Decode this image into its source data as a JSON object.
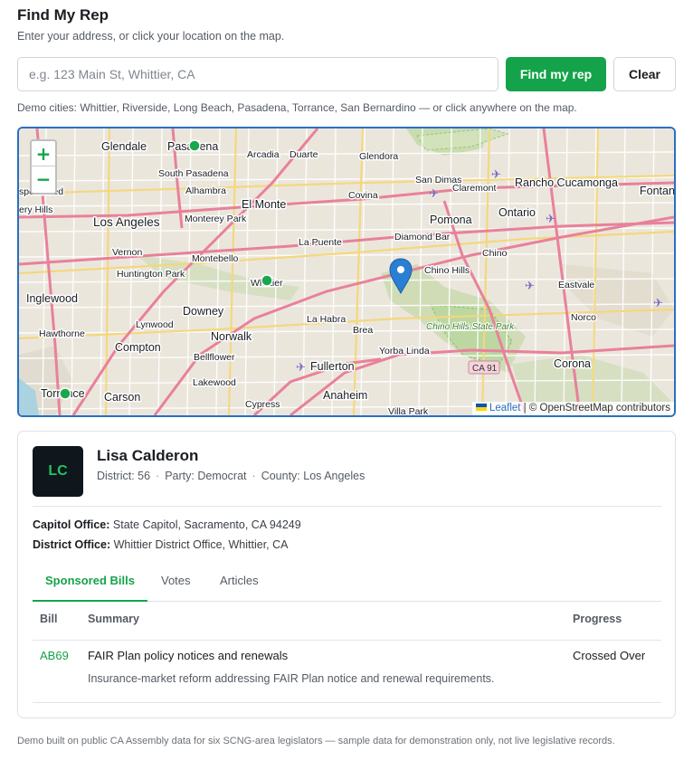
{
  "header": {
    "title": "Find My Rep",
    "subtitle": "Enter your address, or click your location on the map."
  },
  "search": {
    "placeholder": "e.g. 123 Main St, Whittier, CA",
    "value": "",
    "submit_label": "Find my rep",
    "clear_label": "Clear"
  },
  "demo_hint": "Demo cities: Whittier, Riverside, Long Beach, Pasadena, Torrance, San Bernardino — or click anywhere on the map.",
  "map": {
    "zoom_in": "+",
    "zoom_out": "−",
    "attribution_leaflet": "Leaflet",
    "attribution_rest": "| © OpenStreetMap contributors",
    "places": {
      "glendale": "Glendale",
      "pasadena": "Pasadena",
      "arcadia": "Arcadia",
      "duarte": "Duarte",
      "glendora": "Glendora",
      "south_pasadena": "South Pasadena",
      "alhambra": "Alhambra",
      "san_dimas": "San Dimas",
      "claremont": "Claremont",
      "rancho_cucamonga": "Rancho Cucamonga",
      "fontana": "Fontan",
      "covina": "Covina",
      "sponsored": "sponsored",
      "hills": "ery Hills",
      "el_monte": "El Monte",
      "monterey_park": "Monterey Park",
      "los_angeles": "Los Angeles",
      "pomona": "Pomona",
      "ontario": "Ontario",
      "la_puente": "La Puente",
      "diamond_bar": "Diamond Bar",
      "montebello": "Montebello",
      "vernon": "Vernon",
      "huntington_park": "Huntington Park",
      "chino": "Chino",
      "chino_hills": "Chino Hills",
      "whittier": "Whittier",
      "eastvale": "Eastvale",
      "inglewood": "Inglewood",
      "downey": "Downey",
      "la_habra": "La Habra",
      "lynwood": "Lynwood",
      "brea": "Brea",
      "chino_hills_park": "Chino Hills State Park",
      "norco": "Norco",
      "hawthorne": "Hawthorne",
      "norwalk": "Norwalk",
      "compton": "Compton",
      "yorba_linda": "Yorba Linda",
      "bellflower": "Bellflower",
      "fullerton": "Fullerton",
      "ca91": "CA 91",
      "corona": "Corona",
      "lakewood": "Lakewood",
      "torrance": "Torrance",
      "carson": "Carson",
      "anaheim": "Anaheim",
      "cypress": "Cypress",
      "villa_park": "Villa Park"
    }
  },
  "rep": {
    "initials": "LC",
    "name": "Lisa Calderon",
    "district": "District: 56",
    "party": "Party: Democrat",
    "county": "County: Los Angeles",
    "separator": "·",
    "capitol_label": "Capitol Office:",
    "capitol_value": "State Capitol, Sacramento, CA 94249",
    "district_label": "District Office:",
    "district_value": "Whittier District Office, Whittier, CA"
  },
  "tabs": [
    {
      "label": "Sponsored Bills",
      "active": true
    },
    {
      "label": "Votes",
      "active": false
    },
    {
      "label": "Articles",
      "active": false
    }
  ],
  "bills_table": {
    "columns": [
      "Bill",
      "Summary",
      "Progress"
    ],
    "rows": [
      {
        "bill": "AB69",
        "summary": "FAIR Plan policy notices and renewals",
        "progress": "Crossed Over",
        "description": "Insurance-market reform addressing FAIR Plan notice and renewal requirements."
      }
    ]
  },
  "footer": "Demo built on public CA Assembly data for six SCNG-area legislators — sample data for demonstration only, not live legislative records.",
  "colors": {
    "accent_green": "#14a34a",
    "map_border_blue": "#2a6fc2",
    "marker_blue": "#2a7fd4",
    "city_dot_green": "#18a84b"
  }
}
